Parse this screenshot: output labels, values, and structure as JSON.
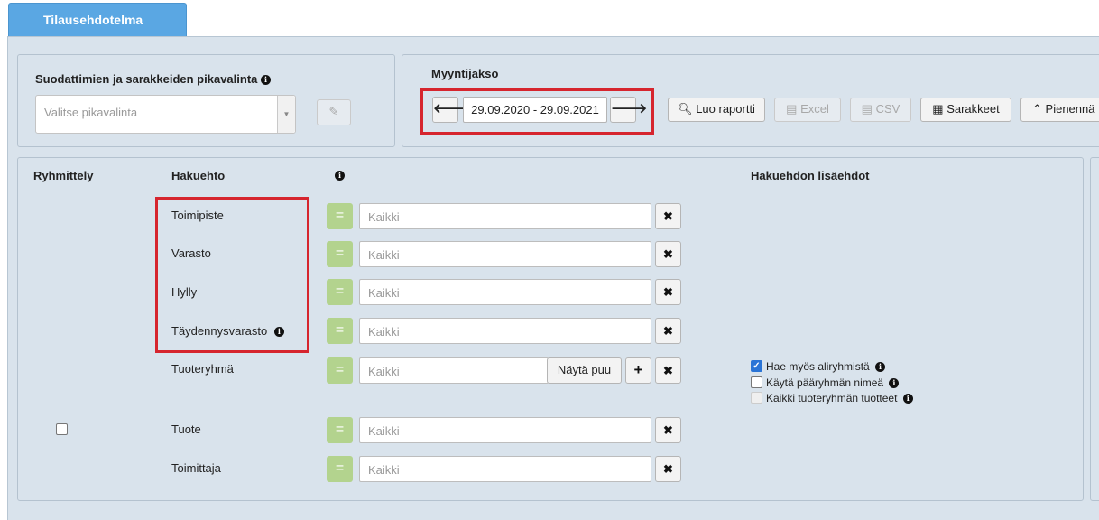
{
  "tab": {
    "label": "Tilausehdotelma"
  },
  "quickselect": {
    "title": "Suodattimien ja sarakkeiden pikavalinta",
    "placeholder": "Valitse pikavalinta"
  },
  "period": {
    "title": "Myyntijakso",
    "range": "29.09.2020 - 29.09.2021"
  },
  "toolbar": {
    "create_report": "Luo raportti",
    "excel": "Excel",
    "csv": "CSV",
    "columns": "Sarakkeet",
    "minimize": "Pienennä"
  },
  "filters": {
    "header_grouping": "Ryhmittely",
    "header_condition": "Hakuehto",
    "header_extra": "Hakuehdon lisäehdot",
    "equals_symbol": "=",
    "remove_symbol": "✖",
    "rows": [
      {
        "label": "Toimipiste",
        "value": "Kaikki"
      },
      {
        "label": "Varasto",
        "value": "Kaikki"
      },
      {
        "label": "Hylly",
        "value": "Kaikki"
      },
      {
        "label": "Täydennysvarasto",
        "value": "Kaikki"
      },
      {
        "label": "Tuoteryhmä",
        "value": "Kaikki",
        "tree_button": "Näytä puu"
      },
      {
        "label": "Tuote",
        "value": "Kaikki"
      },
      {
        "label": "Toimittaja",
        "value": "Kaikki"
      }
    ],
    "product_group_options": [
      {
        "label": "Hae myös aliryhmistä",
        "checked": true
      },
      {
        "label": "Käytä pääryhmän nimeä",
        "checked": false
      },
      {
        "label": "Kaikki tuoteryhmän tuotteet",
        "checked": false,
        "disabled": true
      }
    ]
  },
  "colors": {
    "tab": "#5aa7e3",
    "highlight": "#d6252e",
    "equals": "#b3d38e",
    "background": "#d9e3ec"
  }
}
